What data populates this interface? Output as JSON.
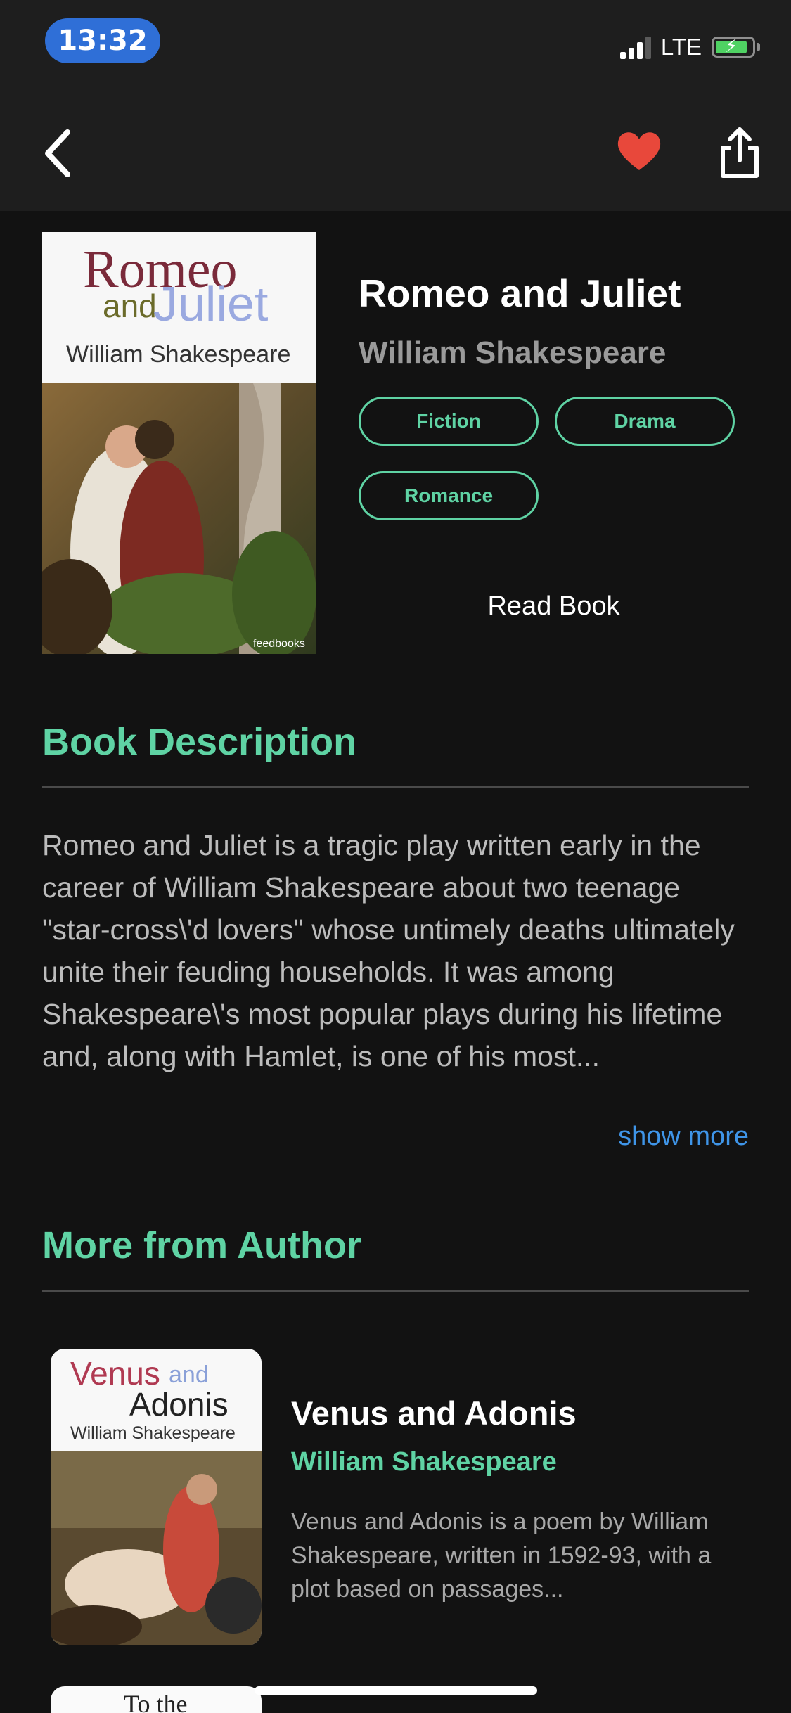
{
  "status_bar": {
    "time": "13:32",
    "network": "LTE"
  },
  "nav": {
    "icons": [
      "chevron-left-icon",
      "heart-icon",
      "share-icon"
    ],
    "favorite_color": "#e8483b"
  },
  "book": {
    "title": "Romeo and Juliet",
    "author": "William Shakespeare",
    "cover": {
      "line1": "Romeo",
      "line2a": "and",
      "line2b": "Juliet",
      "author": "William Shakespeare",
      "publisher_mark": "feedbooks"
    },
    "tags": [
      "Fiction",
      "Drama",
      "Romance"
    ],
    "read_label": "Read Book"
  },
  "description": {
    "heading": "Book Description",
    "text": "Romeo and Juliet is a tragic play written early in the career of William Shakespeare about two teenage \"star-cross\\'d lovers\" whose untimely deaths ultimately unite their feuding households. It was among Shakespeare\\'s most popular plays during his lifetime and, along with Hamlet, is one of his most...",
    "show_more": "show more"
  },
  "more_from_author": {
    "heading": "More from Author",
    "items": [
      {
        "title": "Venus and Adonis",
        "author": "William Shakespeare",
        "description": "Venus and Adonis is a poem by William Shakespeare, written in 1592-93, with a plot based on passages...",
        "cover": {
          "line1": "Venus",
          "line1b": "and",
          "line2": "Adonis",
          "author": "William Shakespeare"
        }
      },
      {
        "cover": {
          "line1": "To the"
        }
      }
    ]
  },
  "colors": {
    "accent": "#5fd3a4",
    "link": "#3f95e8",
    "background": "#121212",
    "toolbar": "#1e1e1e"
  }
}
